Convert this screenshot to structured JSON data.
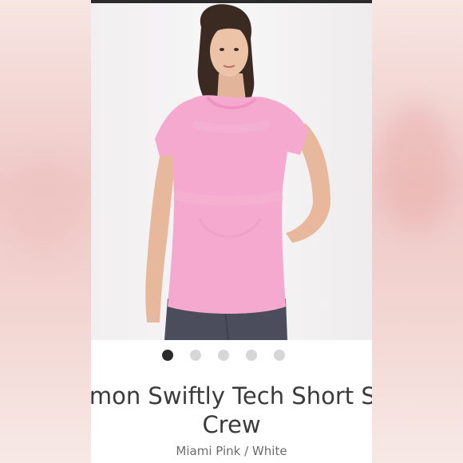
{
  "product": {
    "title_line1": "emon Swiftly Tech Short Sle",
    "title_line2": "Crew",
    "color": "Miami Pink / White"
  },
  "carousel": {
    "count": 5,
    "active_index": 0
  },
  "image": {
    "alt_icon": "product-photo",
    "shirt_color": "#f6a9cf",
    "pants_color": "#4a4c5a"
  }
}
